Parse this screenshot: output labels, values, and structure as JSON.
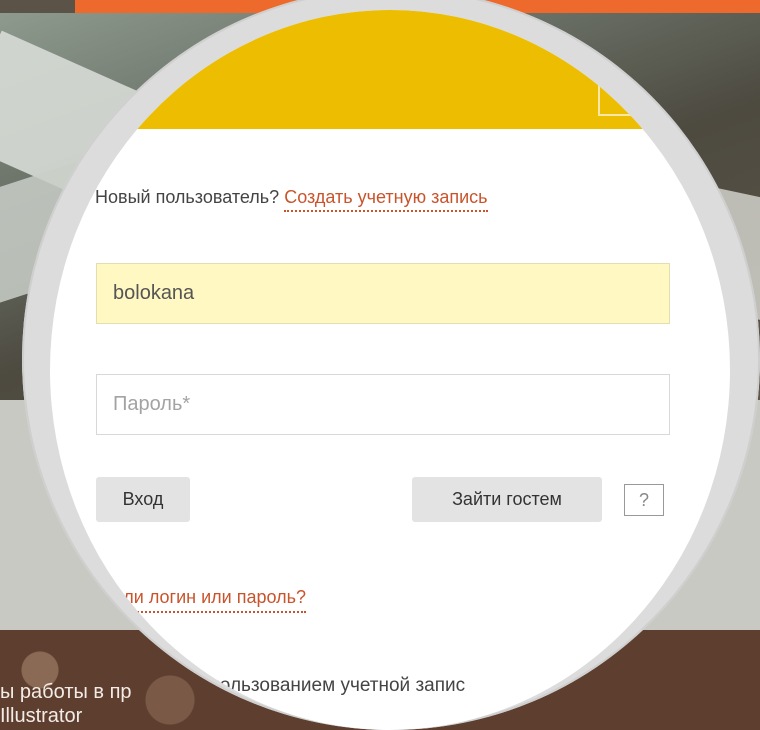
{
  "background": {
    "hero_text": "",
    "course_line1": "ы работы в пр",
    "course_line2": "Illustrator",
    "colors": {
      "topbar": "#ee6a2c",
      "modal_header": "#ecbd00",
      "link": "#c9542c",
      "autofill": "#fff8c2"
    }
  },
  "modal": {
    "title": "",
    "close_icon": "close-icon",
    "new_user": {
      "prompt": "Новый пользователь?",
      "create_link": "Создать учетную запись"
    },
    "login_field": {
      "value": "bolokana"
    },
    "password_field": {
      "placeholder": "Пароль*"
    },
    "buttons": {
      "login": "Вход",
      "guest": "Зайти гостем",
      "help": "?"
    },
    "forgot_link": "абыли логин или пароль?",
    "social_text": "спользованием учетной запис"
  }
}
